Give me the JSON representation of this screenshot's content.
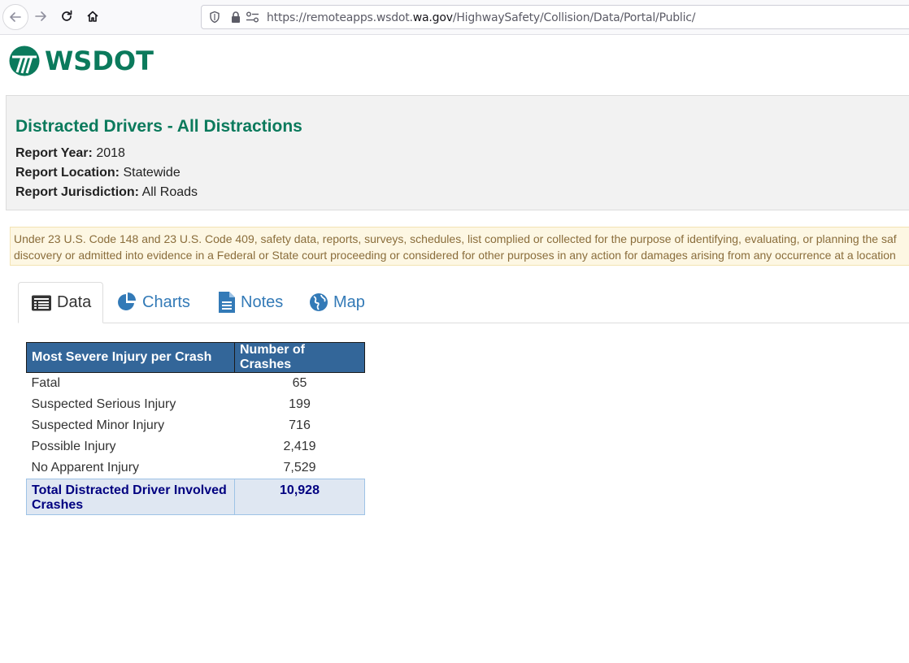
{
  "browser": {
    "url_prefix": "https://remoteapps.wsdot.",
    "url_domain": "wa.gov",
    "url_suffix": "/HighwaySafety/Collision/Data/Portal/Public/"
  },
  "logo": {
    "text": "WSDOT",
    "color": "#0b7a5c"
  },
  "report": {
    "title": "Distracted Drivers - All Distractions",
    "year_label": "Report Year:",
    "year_value": "2018",
    "location_label": "Report Location:",
    "location_value": "Statewide",
    "jurisdiction_label": "Report Jurisdiction:",
    "jurisdiction_value": "All Roads"
  },
  "disclaimer": {
    "line1": "Under 23 U.S. Code 148 and 23 U.S. Code 409, safety data, reports, surveys, schedules, list complied or collected for the purpose of identifying, evaluating, or planning the saf",
    "line2": "discovery or admitted into evidence in a Federal or State court proceeding or considered for other purposes in any action for damages arising from any occurrence at a location"
  },
  "tabs": [
    {
      "label": "Data",
      "icon": "table-icon",
      "active": true
    },
    {
      "label": "Charts",
      "icon": "pie-chart-icon",
      "active": false
    },
    {
      "label": "Notes",
      "icon": "document-icon",
      "active": false
    },
    {
      "label": "Map",
      "icon": "globe-icon",
      "active": false
    }
  ],
  "table": {
    "headers": [
      "Most Severe Injury per Crash",
      "Number of Crashes"
    ],
    "rows": [
      {
        "label": "Fatal",
        "value": "65"
      },
      {
        "label": "Suspected Serious Injury",
        "value": "199"
      },
      {
        "label": "Suspected Minor Injury",
        "value": "716"
      },
      {
        "label": "Possible Injury",
        "value": "2,419"
      },
      {
        "label": "No Apparent Injury",
        "value": "7,529"
      }
    ],
    "total": {
      "label": "Total Distracted Driver Involved Crashes",
      "value": "10,928"
    }
  },
  "colors": {
    "brand": "#0b7a5c",
    "header_bg": "#336699",
    "link": "#337ab7",
    "total_text": "#000080"
  }
}
